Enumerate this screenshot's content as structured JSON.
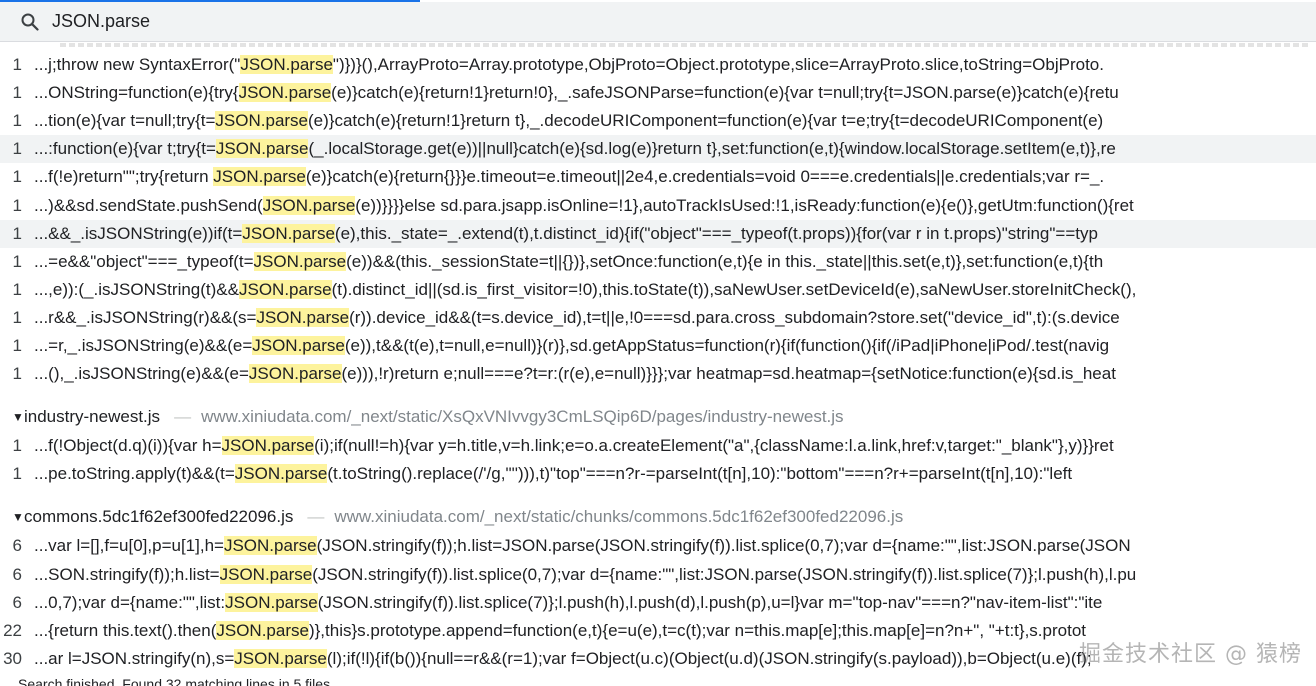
{
  "search": {
    "query": "JSON.parse",
    "icon": "search-icon"
  },
  "highlight_color": "#fdf39d",
  "groups": [
    {
      "file": null,
      "rows": [
        {
          "line": "1",
          "pre": "...j;throw new SyntaxError(\"",
          "match": "JSON.parse",
          "post": "\")})}(),ArrayProto=Array.prototype,ObjProto=Object.prototype,slice=ArrayProto.slice,toString=ObjProto."
        },
        {
          "line": "1",
          "pre": "...ONString=function(e){try{",
          "match": "JSON.parse",
          "post": "(e)}catch(e){return!1}return!0},_.safeJSONParse=function(e){var t=null;try{t=JSON.parse(e)}catch(e){retu"
        },
        {
          "line": "1",
          "pre": "...tion(e){var t=null;try{t=",
          "match": "JSON.parse",
          "post": "(e)}catch(e){return!1}return t},_.decodeURIComponent=function(e){var t=e;try{t=decodeURIComponent(e)"
        },
        {
          "line": "1",
          "pre": "...:function(e){var t;try{t=",
          "match": "JSON.parse",
          "post": "(_.localStorage.get(e))||null}catch(e){sd.log(e)}return t},set:function(e,t){window.localStorage.setItem(e,t)},re"
        },
        {
          "line": "1",
          "pre": "...f(!e)return\"\";try{return ",
          "match": "JSON.parse",
          "post": "(e)}catch(e){return{}}}e.timeout=e.timeout||2e4,e.credentials=void 0===e.credentials||e.credentials;var r=_."
        },
        {
          "line": "1",
          "pre": "...)&&sd.sendState.pushSend(",
          "match": "JSON.parse",
          "post": "(e))}}}}else sd.para.jsapp.isOnline=!1},autoTrackIsUsed:!1,isReady:function(e){e()},getUtm:function(){ret"
        },
        {
          "line": "1",
          "pre": "...&&_.isJSONString(e))if(t=",
          "match": "JSON.parse",
          "post": "(e),this._state=_.extend(t),t.distinct_id){if(\"object\"===_typeof(t.props)){for(var r in t.props)\"string\"==typ"
        },
        {
          "line": "1",
          "pre": "...=e&&\"object\"===_typeof(t=",
          "match": "JSON.parse",
          "post": "(e))&&(this._sessionState=t||{})},setOnce:function(e,t){e in this._state||this.set(e,t)},set:function(e,t){th"
        },
        {
          "line": "1",
          "pre": "...,e)):(_.isJSONString(t)&&",
          "match": "JSON.parse",
          "post": "(t).distinct_id||(sd.is_first_visitor=!0),this.toState(t)),saNewUser.setDeviceId(e),saNewUser.storeInitCheck(),"
        },
        {
          "line": "1",
          "pre": "...r&&_.isJSONString(r)&&(s=",
          "match": "JSON.parse",
          "post": "(r)).device_id&&(t=s.device_id),t=t||e,!0===sd.para.cross_subdomain?store.set(\"device_id\",t):(s.device"
        },
        {
          "line": "1",
          "pre": "...=r,_.isJSONString(e)&&(e=",
          "match": "JSON.parse",
          "post": "(e)),t&&(t(e),t=null,e=null)}(r)},sd.getAppStatus=function(r){if(function(){if(/iPad|iPhone|iPod/.test(navig"
        },
        {
          "line": "1",
          "pre": "...(),_.isJSONString(e)&&(e=",
          "match": "JSON.parse",
          "post": "(e))),!r)return e;null===e?t=r:(r(e),e=null)}}};var heatmap=sd.heatmap={setNotice:function(e){sd.is_heat"
        }
      ]
    },
    {
      "file": {
        "name": "industry-newest.js",
        "url": "www.xiniudata.com/_next/static/XsQxVNIvvgy3CmLSQip6D/pages/industry-newest.js"
      },
      "rows": [
        {
          "line": "1",
          "pre": "...f(!Object(d.q)(i)){var h=",
          "match": "JSON.parse",
          "post": "(i);if(null!=h){var y=h.title,v=h.link;e=o.a.createElement(\"a\",{className:l.a.link,href:v,target:\"_blank\"},y)}}ret"
        },
        {
          "line": "1",
          "pre": "...pe.toString.apply(t)&&(t=",
          "match": "JSON.parse",
          "post": "(t.toString().replace(/'/g,'\"'))),t)\"top\"===n?r-=parseInt(t[n],10):\"bottom\"===n?r+=parseInt(t[n],10):\"left"
        }
      ]
    },
    {
      "file": {
        "name": "commons.5dc1f62ef300fed22096.js",
        "url": "www.xiniudata.com/_next/static/chunks/commons.5dc1f62ef300fed22096.js"
      },
      "rows": [
        {
          "line": "6",
          "pre": "...var l=[],f=u[0],p=u[1],h=",
          "match": "JSON.parse",
          "post": "(JSON.stringify(f));h.list=JSON.parse(JSON.stringify(f)).list.splice(0,7);var d={name:\"\",list:JSON.parse(JSON"
        },
        {
          "line": "6",
          "pre": "...SON.stringify(f));h.list=",
          "match": "JSON.parse",
          "post": "(JSON.stringify(f)).list.splice(0,7);var d={name:\"\",list:JSON.parse(JSON.stringify(f)).list.splice(7)};l.push(h),l.pu"
        },
        {
          "line": "6",
          "pre": "...0,7);var d={name:\"\",list:",
          "match": "JSON.parse",
          "post": "(JSON.stringify(f)).list.splice(7)};l.push(h),l.push(d),l.push(p),u=l}var m=\"top-nav\"===n?\"nav-item-list\":\"ite"
        },
        {
          "line": "22",
          "pre": "...{return this.text().then(",
          "match": "JSON.parse",
          "post": ")},this}s.prototype.append=function(e,t){e=u(e),t=c(t);var n=this.map[e];this.map[e]=n?n+\", \"+t:t},s.protot"
        },
        {
          "line": "30",
          "pre": "...ar l=JSON.stringify(n),s=",
          "match": "JSON.parse",
          "post": "(l);if(!l){if(b()){null==r&&(r=1);var f=Object(u.c)(Object(u.d)(JSON.stringify(s.payload)),b=Object(u.e)(f);"
        }
      ]
    }
  ],
  "status_text": "Search finished. Found 32 matching lines in 5 files",
  "watermark": "掘金技术社区 @ 猿榜"
}
